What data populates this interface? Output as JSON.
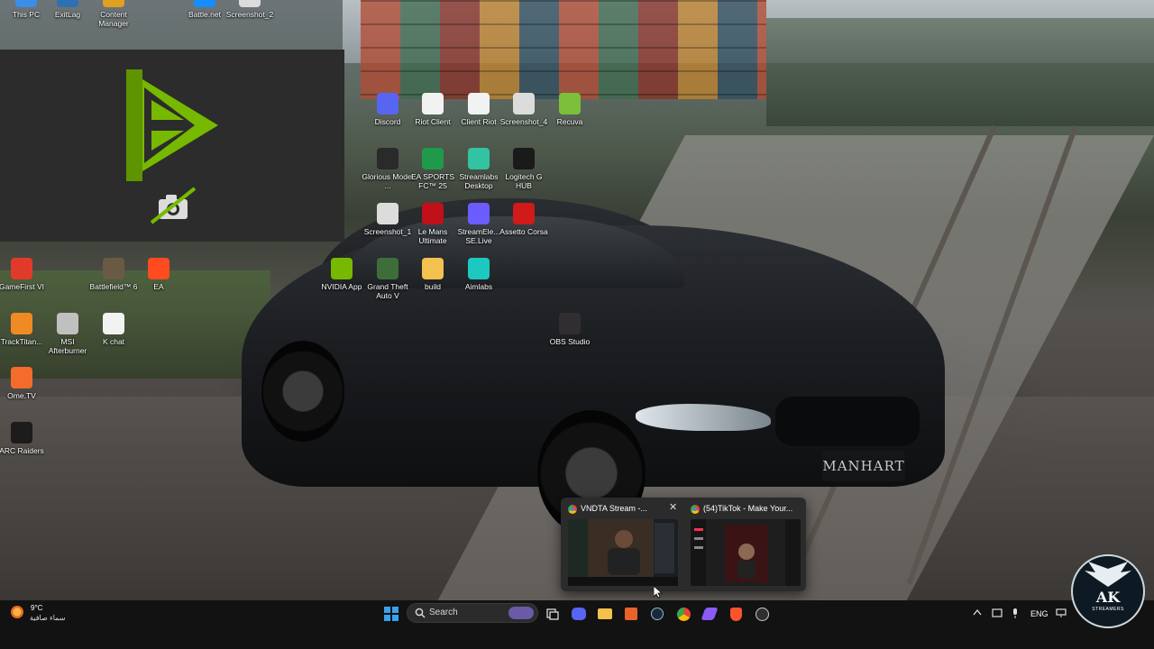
{
  "desktop": {
    "icons": [
      {
        "label": "This PC",
        "icon": "pc-icon",
        "color": "#3a8ee6"
      },
      {
        "label": "ExitLag",
        "icon": "exitlag-icon",
        "color": "#2f6fb3"
      },
      {
        "label": "Content Manager",
        "icon": "content-manager-icon",
        "color": "#e0a020"
      },
      {
        "label": "Battle.net",
        "icon": "battlenet-icon",
        "color": "#148eff"
      },
      {
        "label": "Screenshot_2",
        "icon": "image-file-icon",
        "color": "#dcdcdc"
      },
      {
        "label": "Discord",
        "icon": "discord-icon",
        "color": "#5865f2"
      },
      {
        "label": "Riot Client",
        "icon": "file-icon",
        "color": "#f2f2f2"
      },
      {
        "label": "Client Riot",
        "icon": "file-icon",
        "color": "#f2f2f2"
      },
      {
        "label": "Screenshot_4",
        "icon": "image-file-icon",
        "color": "#dcdcdc"
      },
      {
        "label": "Recuva",
        "icon": "recuva-icon",
        "color": "#7bbf3a"
      },
      {
        "label": "Glorious Model ...",
        "icon": "glorious-icon",
        "color": "#2a2a2a"
      },
      {
        "label": "EA SPORTS FC™ 25",
        "icon": "ea-fc-icon",
        "color": "#1f9a4a"
      },
      {
        "label": "Streamlabs Desktop",
        "icon": "streamlabs-icon",
        "color": "#31c3a2"
      },
      {
        "label": "Logitech G HUB",
        "icon": "logitech-icon",
        "color": "#1a1a1a"
      },
      {
        "label": "Screenshot_1",
        "icon": "image-file-icon",
        "color": "#dcdcdc"
      },
      {
        "label": "Le Mans Ultimate",
        "icon": "le-mans-icon",
        "color": "#c0101a"
      },
      {
        "label": "StreamEle... SE.Live",
        "icon": "streamelements-icon",
        "color": "#6b5cff"
      },
      {
        "label": "Assetto Corsa",
        "icon": "assetto-corsa-icon",
        "color": "#d11a1a"
      },
      {
        "label": "GameFirst VI",
        "icon": "gamefirst-icon",
        "color": "#e23a2a"
      },
      {
        "label": "Battlefield™ 6",
        "icon": "battlefield-icon",
        "color": "#6a5a44"
      },
      {
        "label": "EA",
        "icon": "ea-icon",
        "color": "#ff4b1f"
      },
      {
        "label": "NVIDIA App",
        "icon": "nvidia-icon",
        "color": "#76b900"
      },
      {
        "label": "Grand Theft Auto V",
        "icon": "gta-icon",
        "color": "#3e6d3a"
      },
      {
        "label": "build",
        "icon": "folder-icon",
        "color": "#f2c14e"
      },
      {
        "label": "Aimlabs",
        "icon": "aimlabs-icon",
        "color": "#1cc8c0"
      },
      {
        "label": "TrackTitan...",
        "icon": "tracktitan-icon",
        "color": "#f08a24"
      },
      {
        "label": "MSI Afterburner",
        "icon": "msi-afterburner-icon",
        "color": "#c0c0c0"
      },
      {
        "label": "K chat",
        "icon": "file-icon",
        "color": "#f2f2f2"
      },
      {
        "label": "OBS Studio",
        "icon": "obs-icon",
        "color": "#302e31"
      },
      {
        "label": "Ome.TV",
        "icon": "ometv-icon",
        "color": "#f36c2b"
      },
      {
        "label": "ARC Raiders",
        "icon": "arc-raiders-icon",
        "color": "#1c1c1c"
      }
    ]
  },
  "car": {
    "plate_text": "MANHART"
  },
  "thumbnails": [
    {
      "title": "VNDTA Stream -...",
      "close": "✕"
    },
    {
      "title": "(54)TikTok - Make Your..."
    }
  ],
  "taskbar": {
    "weather": {
      "temp": "9°C",
      "desc": "سماء صافية"
    },
    "search_placeholder": "Search",
    "apps": [
      "start-icon",
      "search-icon",
      "task-view-icon",
      "discord-icon",
      "file-explorer-icon",
      "adobe-icon",
      "steam-icon",
      "chrome-icon",
      "vs-icon",
      "brave-icon",
      "obs-icon"
    ],
    "tray": {
      "lang": "ENG"
    }
  },
  "watermark": {
    "logo": "AK",
    "sub": "STREAMERS"
  },
  "colors": {
    "accent": "#76b900",
    "taskbar": "#121212",
    "promo_bg": "#2c2c2c"
  }
}
